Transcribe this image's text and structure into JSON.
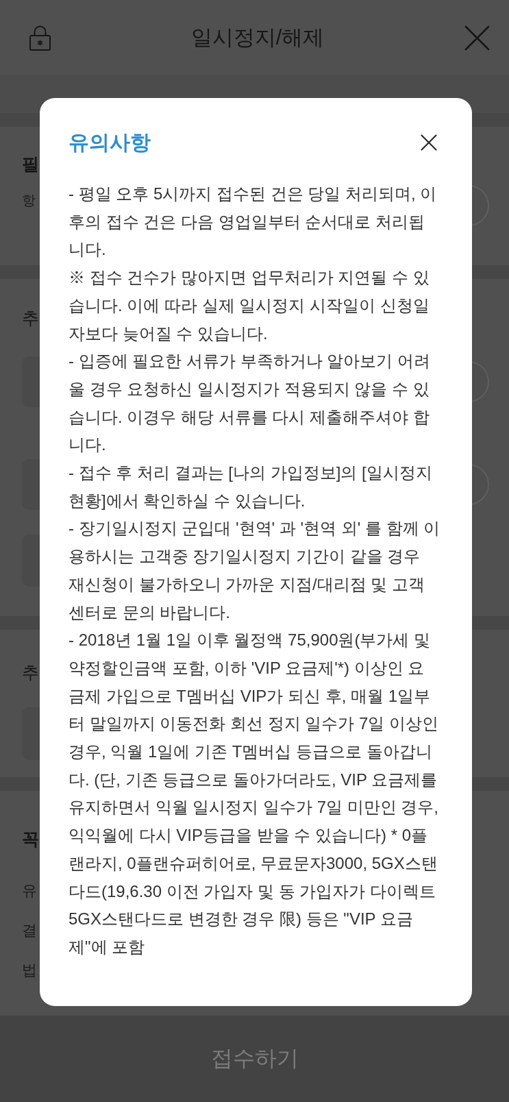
{
  "header": {
    "title": "일시정지/해제"
  },
  "page": {
    "sections": [
      {
        "heading": "필",
        "note": "항"
      },
      {
        "heading": "추"
      },
      {
        "heading": "추"
      },
      {
        "heading": "꼭",
        "lines": [
          "유",
          "결",
          "법"
        ]
      }
    ]
  },
  "submit_button": {
    "label": "접수하기",
    "disabled": true
  },
  "modal": {
    "title": "유의사항",
    "paragraphs": [
      "- 평일 오후 5시까지 접수된 건은 당일 처리되며, 이후의 접수 건은 다음 영업일부터 순서대로 처리됩니다.",
      "※ 접수 건수가 많아지면 업무처리가 지연될 수 있습니다. 이에 따라 실제 일시정지 시작일이 신청일자보다 늦어질 수 있습니다.",
      "- 입증에 필요한 서류가 부족하거나 알아보기 어려울 경우 요청하신 일시정지가 적용되지 않을 수 있습니다. 이경우 해당 서류를 다시 제출해주셔야 합니다.",
      "- 접수 후 처리 결과는 [나의 가입정보]의 [일시정지 현황]에서 확인하실 수 있습니다.",
      "- 장기일시정지 군입대 '현역' 과 '현역 외' 를 함께 이용하시는 고객중 장기일시정지 기간이 같을 경우 재신청이 불가하오니 가까운 지점/대리점 및 고객센터로 문의 바랍니다.",
      "- 2018년 1월 1일 이후 월정액 75,900원(부가세 및 약정할인금액 포함, 이하 'VIP 요금제'*) 이상인 요금제 가입으로 T멤버십 VIP가 되신 후, 매월 1일부터 말일까지 이동전화 회선 정지 일수가 7일 이상인 경우, 익월 1일에 기존 T멤버십 등급으로 돌아갑니다. (단, 기존 등급으로 돌아가더라도, VIP 요금제를 유지하면서 익월 일시정지 일수가 7일 미만인 경우, 익익월에 다시 VIP등급을 받을 수 있습니다) * 0플랜라지, 0플랜슈퍼히어로, 무료문자3000, 5GX스탠다드(19,6.30 이전 가입자 및 동 가입자가 다이렉트 5GX스탠다드로 변경한 경우 限) 등은 \"VIP 요금제\"에 포함"
    ]
  }
}
